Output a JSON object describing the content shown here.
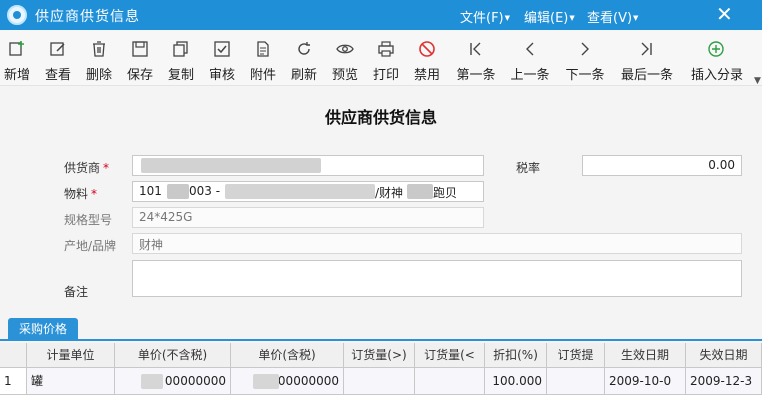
{
  "window": {
    "title": "供应商供货信息",
    "menus": [
      {
        "label": "文件(F)"
      },
      {
        "label": "编辑(E)"
      },
      {
        "label": "查看(V)"
      }
    ],
    "close_glyph": "✕"
  },
  "toolbar": {
    "buttons": [
      {
        "label": "新增",
        "icon": "add-icon"
      },
      {
        "label": "查看",
        "icon": "edit-icon"
      },
      {
        "label": "删除",
        "icon": "trash-icon"
      },
      {
        "label": "保存",
        "icon": "save-icon"
      },
      {
        "label": "复制",
        "icon": "copy-icon"
      },
      {
        "label": "审核",
        "icon": "check-icon"
      },
      {
        "label": "附件",
        "icon": "attachment-icon"
      },
      {
        "label": "刷新",
        "icon": "refresh-icon"
      },
      {
        "label": "预览",
        "icon": "eye-icon"
      },
      {
        "label": "打印",
        "icon": "printer-icon"
      },
      {
        "label": "禁用",
        "icon": "ban-icon"
      },
      {
        "label": "第一条",
        "icon": "first-icon"
      },
      {
        "label": "上一条",
        "icon": "prev-icon"
      },
      {
        "label": "下一条",
        "icon": "next-icon"
      },
      {
        "label": "最后一条",
        "icon": "last-icon"
      },
      {
        "label": "插入分录",
        "icon": "insert-icon"
      }
    ],
    "accent": "#2f9e44",
    "danger": "#e03131"
  },
  "form": {
    "title": "供应商供货信息",
    "supplier": {
      "label": "供货商",
      "required_mark": "*"
    },
    "tax_rate": {
      "label": "税率",
      "value": "0.00"
    },
    "material": {
      "label": "物料",
      "required_mark": "*",
      "value_parts": [
        "101",
        "003 -",
        "/财神",
        "跑贝"
      ]
    },
    "spec": {
      "label": "规格型号",
      "value": "24*425G"
    },
    "origin_brand": {
      "label": "产地/品牌",
      "value": "财神"
    },
    "remark": {
      "label": "备注",
      "value": ""
    }
  },
  "tabs": [
    {
      "label": "采购价格"
    }
  ],
  "grid": {
    "columns": [
      "计量单位",
      "单价(不含税)",
      "单价(含税)",
      "订货量(>)",
      "订货量(<",
      "折扣(%)",
      "订货提",
      "生效日期",
      "失效日期"
    ],
    "rows": [
      {
        "index": "1",
        "unit": "罐",
        "price_ex_tax": "00000000",
        "price_inc_tax": "00000000",
        "qty_gt": "",
        "qty_lt": "",
        "discount": "100.000",
        "lead": "",
        "effective_date": "2009-10-0",
        "expiry_date": "2009-12-3"
      }
    ]
  },
  "colors": {
    "titlebar": "#1f8fd8",
    "tab": "#2b92d8"
  }
}
